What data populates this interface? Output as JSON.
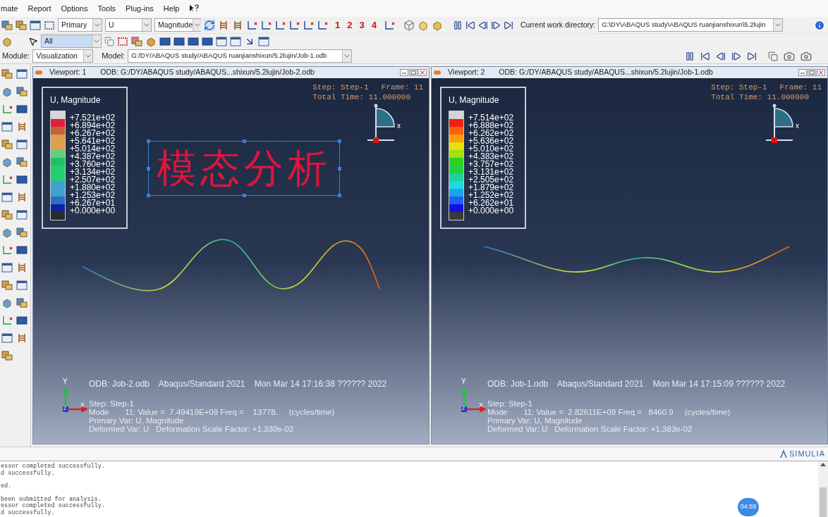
{
  "menu": [
    {
      "label": "mate"
    },
    {
      "label": "Report"
    },
    {
      "label": "Options"
    },
    {
      "label": "Tools"
    },
    {
      "label": "Plug-ins"
    },
    {
      "label": "Help"
    }
  ],
  "toolbar": {
    "result_selects": [
      {
        "value": "Primary"
      },
      {
        "value": "U"
      },
      {
        "value": "Magnitude"
      }
    ],
    "view_numbers": [
      "1",
      "2",
      "3",
      "4"
    ],
    "work_directory_label": "Current work directory:",
    "work_directory": "G:\\DY\\ABAQUS study\\ABAQUS ruanjianshixun\\5.2lujin",
    "selection_filter": "All"
  },
  "context_bar": {
    "module_label": "Module:",
    "module": "Visualization",
    "model_label": "Model:",
    "model": "G:/DY/ABAQUS study/ABAQUS ruanjianshixun/5.2lujin/Job-1.odb"
  },
  "viewports": [
    {
      "title": "Viewport: 1",
      "odb_path": "ODB: G:/DY/ABAQUS study/ABAQUS...shixun/5.2lujin/Job-2.odb",
      "legend": {
        "title": "U, Magnitude",
        "values": [
          "+7.521e+02",
          "+6.894e+02",
          "+6.267e+02",
          "+5.641e+02",
          "+5.014e+02",
          "+4.387e+02",
          "+3.760e+02",
          "+3.134e+02",
          "+2.507e+02",
          "+1.880e+02",
          "+1.253e+02",
          "+6.267e+01",
          "+0.000e+00"
        ],
        "swatches": [
          {
            "color": "#d6d6d6"
          },
          {
            "color": "#e0203a"
          },
          {
            "color": "#c8603a"
          },
          {
            "color": "#dca050"
          },
          {
            "color": "#dca050"
          },
          {
            "color": "#60d080"
          },
          {
            "color": "#20c060"
          },
          {
            "color": "#20d070"
          },
          {
            "color": "#20d070"
          },
          {
            "color": "#40a0d0"
          },
          {
            "color": "#40a0d0"
          },
          {
            "color": "#3070c0"
          },
          {
            "color": "#1020a0"
          },
          {
            "color": "#2a2a2a"
          }
        ]
      },
      "step": "Step: Step-1",
      "frame": "Frame: 11",
      "total_time": "Total Time: 11.000000",
      "triad_label": "x",
      "annotation": "模态分析",
      "info_header": "ODB: Job-2.odb    Abaqus/Standard 2021    Mon Mar 14 17:16:38 ?????? 2022",
      "info_lines": [
        "Step: Step-1",
        "Mode       11: Value =  7.49419E+09 Freq =    13778.     (cycles/time)",
        "Primary Var: U, Magnitude",
        "Deformed Var: U   Deformation Scale Factor: +1.330e-02"
      ],
      "axes": [
        "Y",
        "Z",
        "X"
      ]
    },
    {
      "title": "Viewport: 2",
      "odb_path": "ODB: G:/DY/ABAQUS study/ABAQUS...shixun/5.2lujin/Job-1.odb",
      "legend": {
        "title": "U, Magnitude",
        "values": [
          "+7.514e+02",
          "+6.888e+02",
          "+6.262e+02",
          "+5.636e+02",
          "+5.010e+02",
          "+4.383e+02",
          "+3.757e+02",
          "+3.131e+02",
          "+2.505e+02",
          "+1.879e+02",
          "+1.252e+02",
          "+6.262e+01",
          "+0.000e+00"
        ],
        "swatches": [
          {
            "color": "#d4d4d4"
          },
          {
            "color": "#f02010"
          },
          {
            "color": "#f86010"
          },
          {
            "color": "#f8a010"
          },
          {
            "color": "#e8e010"
          },
          {
            "color": "#a0e010"
          },
          {
            "color": "#30d020"
          },
          {
            "color": "#20d040"
          },
          {
            "color": "#20d0a0"
          },
          {
            "color": "#20d8e0"
          },
          {
            "color": "#20a0f0"
          },
          {
            "color": "#2060f0"
          },
          {
            "color": "#1010e0"
          },
          {
            "color": "#3a3a3a"
          }
        ]
      },
      "step": "Step: Step-1",
      "frame": "Frame: 11",
      "total_time": "Total Time: 11.000000",
      "triad_label": "x",
      "info_header": "ODB: Job-1.odb    Abaqus/Standard 2021    Mon Mar 14 17:15:09 ?????? 2022",
      "info_lines": [
        "Step: Step-1",
        "Mode       11: Value =  2.82611E+09 Freq =   8460.9     (cycles/time)",
        "Primary Var: U, Magnitude",
        "Deformed Var: U   Deformation Scale Factor: +1.383e-02"
      ],
      "axes": [
        "Y",
        "Z",
        "X"
      ]
    }
  ],
  "brand": "SIMULIA",
  "message_groups": [
    [
      "essor completed successfully.",
      "d successfully."
    ],
    [
      "ed."
    ],
    [
      "been submitted for analysis.",
      "essor completed successfully.",
      "d successfully."
    ]
  ],
  "timer_badge": "04:59"
}
